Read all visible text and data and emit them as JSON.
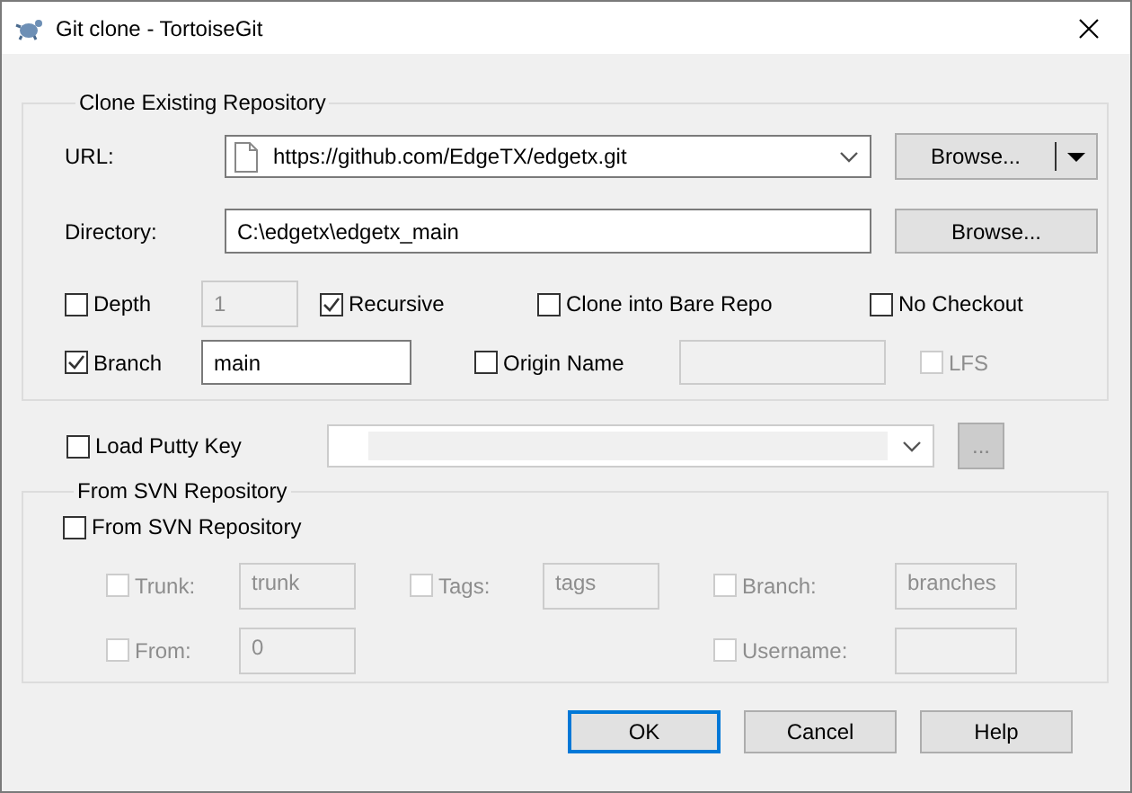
{
  "window": {
    "title": "Git clone - TortoiseGit"
  },
  "clone_group": {
    "title": "Clone Existing Repository",
    "url": {
      "label": "URL:",
      "value": "https://github.com/EdgeTX/edgetx.git",
      "button": "Browse..."
    },
    "directory": {
      "label": "Directory:",
      "value": "C:\\edgetx\\edgetx_main",
      "button": "Browse..."
    },
    "depth": {
      "label": "Depth",
      "checked": false,
      "value": "1",
      "disabled": true
    },
    "recursive": {
      "label": "Recursive",
      "checked": true
    },
    "bare_repo": {
      "label": "Clone into Bare Repo",
      "checked": false
    },
    "no_checkout": {
      "label": "No Checkout",
      "checked": false
    },
    "branch": {
      "label": "Branch",
      "checked": true,
      "value": "main",
      "disabled": false
    },
    "origin_name": {
      "label": "Origin Name",
      "checked": false,
      "disabled": true
    },
    "lfs": {
      "label": "LFS",
      "checked": false,
      "disabled": true
    }
  },
  "putty_key": {
    "label": "Load Putty Key",
    "checked": false,
    "disabled": true,
    "button": "..."
  },
  "svn_group": {
    "title": "From SVN Repository",
    "from_svn": {
      "label": "From SVN Repository",
      "checked": false
    },
    "columns": [
      [
        {
          "label": "Trunk:",
          "checked": false,
          "value": "trunk",
          "disabled": true
        },
        {
          "label": "From:",
          "checked": false,
          "value": "0",
          "disabled": true
        }
      ],
      [
        {
          "label": "Tags:",
          "checked": false,
          "value": "tags",
          "disabled": true
        }
      ],
      [
        {
          "label": "Branch:",
          "checked": false,
          "value": "branches",
          "disabled": true
        },
        {
          "label": "Username:",
          "checked": false,
          "disabled": true
        }
      ]
    ]
  },
  "buttons": [
    {
      "label": "OK",
      "default": true
    },
    {
      "label": "Cancel",
      "default": false
    },
    {
      "label": "Help",
      "default": false
    }
  ]
}
